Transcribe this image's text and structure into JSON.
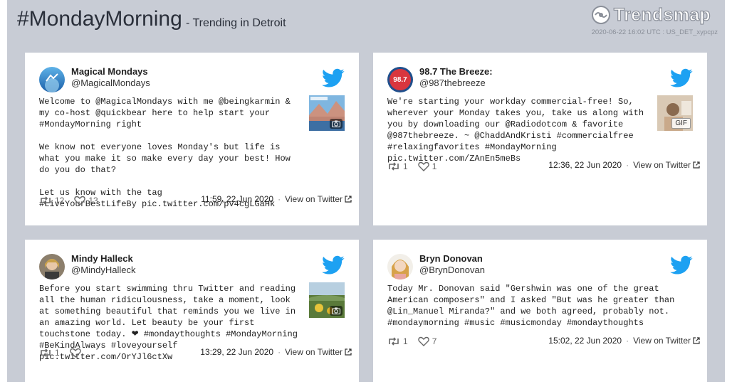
{
  "header": {
    "hashtag": "#MondayMorning",
    "subtitle": "- Trending in Detroit",
    "brand": "Trendsmap",
    "meta": "2020-06-22 16:02 UTC : US_DET_xypcpz"
  },
  "tweets": [
    {
      "name": "Magical Mondays",
      "handle": "@MagicalMondays",
      "text": "Welcome to @MagicalMondays with me @beingkarmin & my co-host @quickbear here to help start your #MondayMorning right\n\nWe know not everyone loves Monday's but life is what you make it so make every day your best! How do you do that?\n\nLet us know with the tag\n#LiveYourBestLifeBy pic.twitter.com/pv4cgLGaHk",
      "retweets": "12",
      "likes": "13",
      "time": "11:59, 22 Jun 2020",
      "view": "View on Twitter",
      "media": "photo"
    },
    {
      "name": "98.7 The Breeze:",
      "handle": "@987thebreeze",
      "text": "We're starting your workday commercial-free! So, wherever your Monday takes you, take us along with you by downloading our @Radiodotcom & favorite @987thebreeze. ~ @ChaddAndKristi #commercialfree #relaxingfavorites #MondayMorning pic.twitter.com/ZAnEn5meBs",
      "retweets": "1",
      "likes": "1",
      "time": "12:36, 22 Jun 2020",
      "view": "View on Twitter",
      "media": "GIF"
    },
    {
      "name": "Mindy Halleck",
      "handle": "@MindyHalleck",
      "text": "Before you start swimming thru Twitter and reading all the human ridiculousness, take a moment, look at something beautiful that reminds you we live in an amazing world. Let beauty be your first touchstone today. ⁣⁣❤ #mondaythoughts #MondayMorning #BeKindAlways #loveyourself pic.twitter.com/OrYJl6ctXw",
      "retweets": "1",
      "likes": "",
      "time": "13:29, 22 Jun 2020",
      "view": "View on Twitter",
      "media": "photo"
    },
    {
      "name": "Bryn Donovan",
      "handle": "@BrynDonovan",
      "text": "Today Mr. Donovan said \"Gershwin was one of the great American composers\" and I asked \"But was he greater than @Lin_Manuel Miranda?\" and we both agreed, probably not.\n#mondaymorning #music #musicmonday #mondaythoughts",
      "retweets": "1",
      "likes": "7",
      "time": "15:02, 22 Jun 2020",
      "view": "View on Twitter",
      "media": ""
    }
  ],
  "colors": {
    "background": "#c8ccd5",
    "twitter_blue": "#1da1f2",
    "card": "#ffffff"
  },
  "icons": [
    "twitter-bird-icon",
    "retweet-icon",
    "heart-icon",
    "external-link-icon",
    "camera-icon",
    "trendsmap-logo-icon"
  ]
}
